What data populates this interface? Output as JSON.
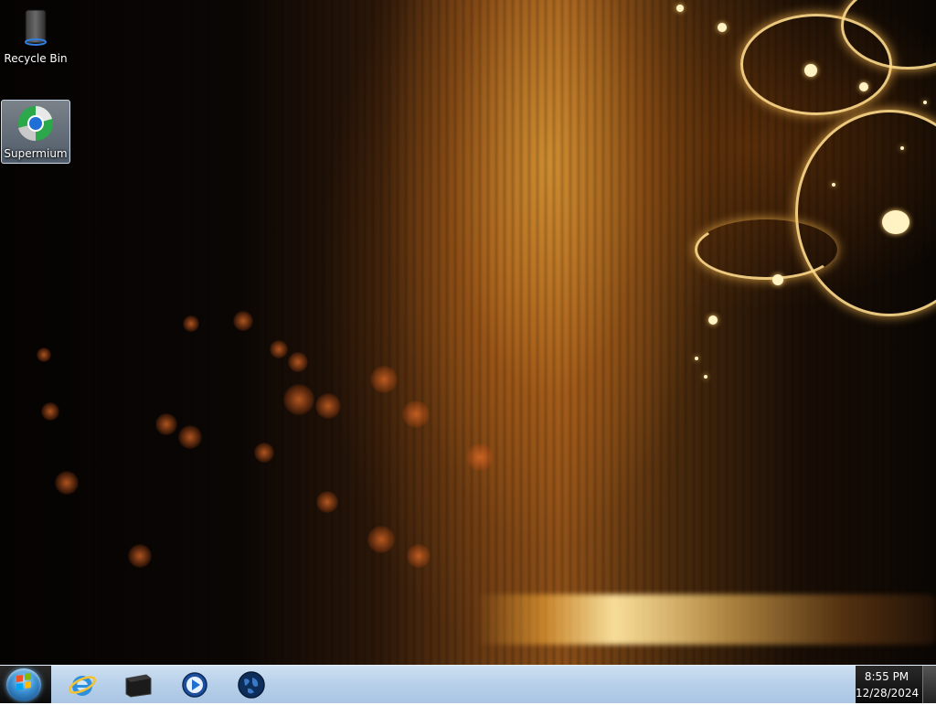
{
  "desktop": {
    "icons": [
      {
        "label": "Recycle Bin",
        "icon": "recycle-bin-icon"
      },
      {
        "label": "Supermium",
        "icon": "supermium-browser-icon"
      }
    ]
  },
  "taskbar": {
    "start_button": "windows-start-orb",
    "pinned": [
      {
        "icon": "internet-explorer-icon"
      },
      {
        "icon": "file-explorer-icon"
      },
      {
        "icon": "media-player-icon"
      },
      {
        "icon": "globe-browser-icon"
      }
    ],
    "clock": {
      "time": "8:55 PM",
      "date": "12/28/2024"
    }
  }
}
